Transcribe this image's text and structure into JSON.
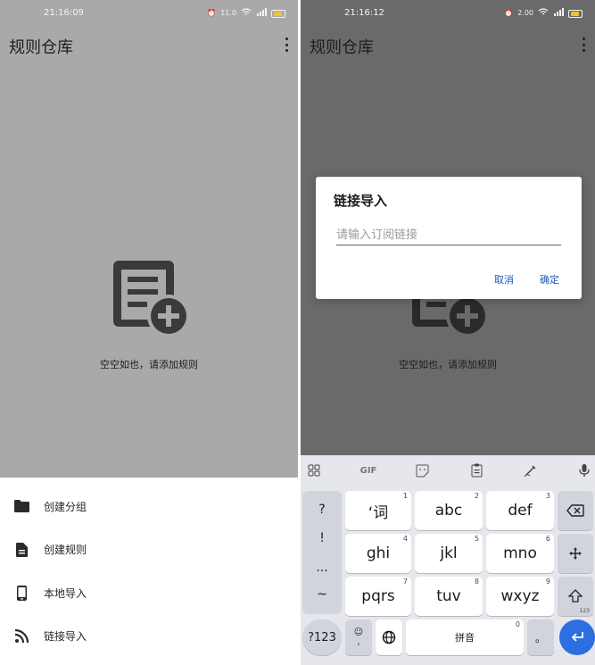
{
  "left": {
    "status": {
      "time": "21:16:09",
      "speed": "11.0"
    },
    "title": "规则仓库",
    "empty_text": "空空如也，请添加规则",
    "sheet": [
      {
        "label": "创建分组",
        "icon": "folder-icon"
      },
      {
        "label": "创建规则",
        "icon": "document-icon"
      },
      {
        "label": "本地导入",
        "icon": "phone-icon"
      },
      {
        "label": "链接导入",
        "icon": "rss-icon"
      }
    ]
  },
  "right": {
    "status": {
      "time": "21:16:12",
      "speed": "2.00"
    },
    "title": "规则仓库",
    "empty_text": "空空如也，请添加规则",
    "dialog": {
      "title": "链接导入",
      "input_placeholder": "请输入订阅链接",
      "cancel": "取消",
      "confirm": "确定"
    },
    "keyboard": {
      "toolbar": [
        "grid-icon",
        "GIF",
        "sticker-icon",
        "clipboard-icon",
        "handwriting-icon",
        "mic-icon"
      ],
      "gif_label": "GIF",
      "symbols": [
        "?",
        "!",
        "...",
        "~"
      ],
      "keys": [
        {
          "label": "‘词",
          "hint": "1"
        },
        {
          "label": "abc",
          "hint": "2"
        },
        {
          "label": "def",
          "hint": "3"
        },
        {
          "label": "ghi",
          "hint": "4"
        },
        {
          "label": "jkl",
          "hint": "5"
        },
        {
          "label": "mno",
          "hint": "6"
        },
        {
          "label": "pqrs",
          "hint": "7"
        },
        {
          "label": "tuv",
          "hint": "8"
        },
        {
          "label": "wxyz",
          "hint": "9"
        }
      ],
      "num_switch": "?123",
      "space_label": "拼音",
      "space_hint": "0",
      "emoji_comma": ",",
      "period": "。",
      "shift_hint": "123"
    },
    "colors": {
      "accent": "#2459b3",
      "go": "#2b6fe0"
    }
  }
}
